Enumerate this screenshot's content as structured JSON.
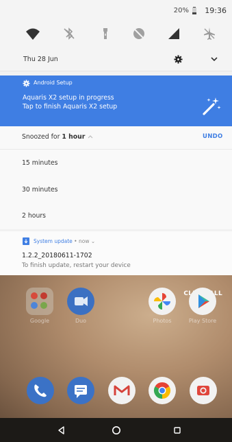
{
  "status_bar": {
    "battery": "20%",
    "time": "19:36"
  },
  "quick_settings": {
    "date": "Thu 28 Jun",
    "tiles": [
      "wifi-icon",
      "bluetooth-off-icon",
      "flashlight-icon",
      "do-not-disturb-icon",
      "mobile-signal-icon",
      "airplane-icon"
    ]
  },
  "setup_notification": {
    "app": "Android Setup",
    "line1": "Aquaris X2 setup in progress",
    "line2": "Tap to finish Aquaris X2 setup"
  },
  "snooze": {
    "prefix": "Snoozed for ",
    "duration": "1 hour",
    "undo": "UNDO",
    "options": [
      "15 minutes",
      "30 minutes",
      "2 hours"
    ]
  },
  "update_notification": {
    "app": "System update",
    "meta": " • now ⌄",
    "title": "1.2.2_20180611-1702",
    "body": "To finish update, restart your device"
  },
  "home": {
    "clear_all": "CLEAR ALL",
    "apps_row1": [
      "Google",
      "Duo",
      "Photos",
      "Play Store"
    ],
    "apps_row2": [
      "phone",
      "messages",
      "gmail",
      "chrome",
      "camera"
    ]
  },
  "colors": {
    "accent": "#3f7ee3",
    "setup_card": "#3f7ee3"
  }
}
